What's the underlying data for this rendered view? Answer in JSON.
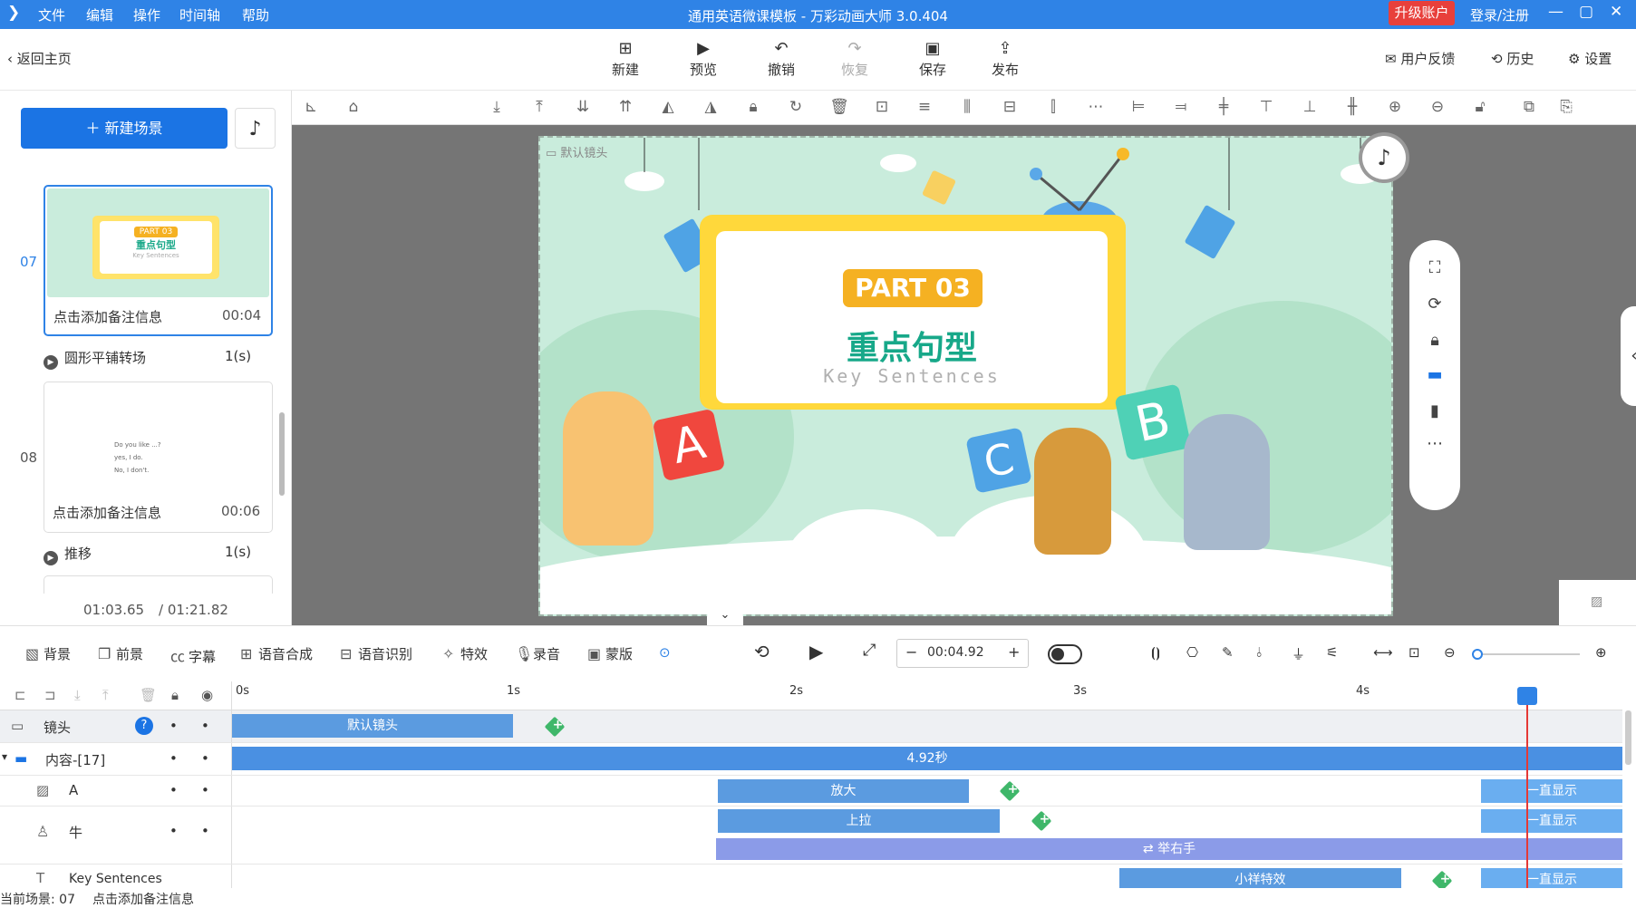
{
  "app": {
    "title": "通用英语微课模板 - 万彩动画大师 3.0.404",
    "upgrade_label": "升级账户",
    "login_label": "登录/注册"
  },
  "menu": [
    "文件",
    "编辑",
    "操作",
    "时间轴",
    "帮助"
  ],
  "toolbar": {
    "back": "返回主页",
    "new": "新建",
    "preview": "预览",
    "undo": "撤销",
    "redo": "恢复",
    "save": "保存",
    "publish": "发布",
    "feedback": "用户反馈",
    "history": "历史",
    "settings": "设置"
  },
  "left": {
    "new_scene": "新建场景",
    "scenes": [
      {
        "num": "07",
        "note": "点击添加备注信息",
        "duration": "00:04",
        "part": "PART 03",
        "cn": "重点句型",
        "en": "Key Sentences"
      },
      {
        "num": "08",
        "note": "点击添加备注信息",
        "duration": "00:06",
        "lines": [
          "Do you like ...?",
          "yes, I do.",
          "No, I don't."
        ]
      }
    ],
    "transitions": [
      {
        "name": "圆形平铺转场",
        "dur": "1(s)"
      },
      {
        "name": "推移",
        "dur": "1(s)"
      }
    ],
    "time_current": "01:03.65",
    "time_total": "/ 01:21.82"
  },
  "stage": {
    "camera_label": "默认镜头",
    "part": "PART 03",
    "cn_title": "重点句型",
    "en_title": "Key Sentences",
    "letters": [
      "A",
      "B",
      "C"
    ]
  },
  "bottom": {
    "items": [
      "背景",
      "前景",
      "字幕",
      "语音合成",
      "语音识别",
      "特效",
      "录音",
      "蒙版"
    ],
    "time": "00:04.92"
  },
  "timeline": {
    "ticks": [
      "0s",
      "1s",
      "2s",
      "3s",
      "4s"
    ],
    "rows": [
      {
        "label": "镜头",
        "bars": [
          {
            "text": "默认镜头"
          }
        ]
      },
      {
        "label": "内容-[17]",
        "bars": [
          {
            "text": "4.92秒"
          }
        ]
      },
      {
        "label": "A",
        "bars": [
          {
            "text": "放大"
          },
          {
            "text": "一直显示"
          }
        ]
      },
      {
        "label": "牛",
        "bars": [
          {
            "text": "上拉"
          },
          {
            "text": "一直显示"
          },
          {
            "text": "举右手"
          }
        ]
      },
      {
        "label": "Key Sentences",
        "bars": [
          {
            "text": "小祥特效"
          },
          {
            "text": "一直显示"
          }
        ]
      }
    ]
  },
  "status": {
    "scene": "当前场景: 07",
    "note": "点击添加备注信息"
  }
}
